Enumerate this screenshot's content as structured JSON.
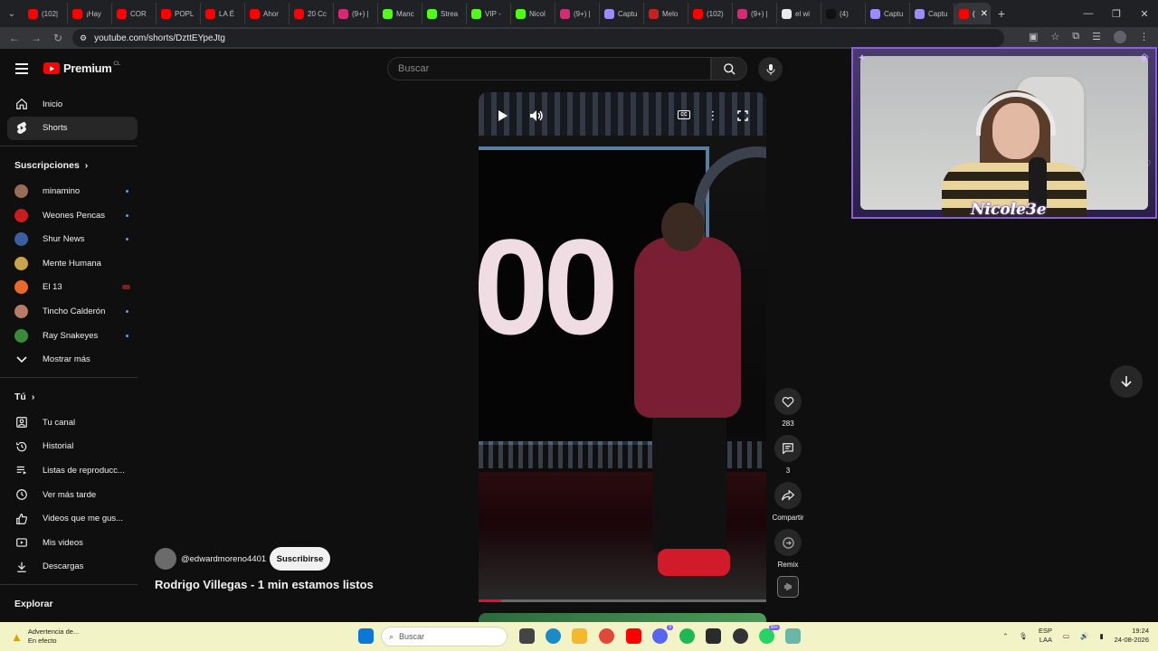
{
  "browser": {
    "tabs": [
      {
        "label": "(102|",
        "color": "#ff0000"
      },
      {
        "label": "¡Hay",
        "color": "#ff0000"
      },
      {
        "label": "COR",
        "color": "#ff0000"
      },
      {
        "label": "POPL",
        "color": "#ff0000"
      },
      {
        "label": "LA É",
        "color": "#ff0000"
      },
      {
        "label": "Ahor",
        "color": "#ff0000"
      },
      {
        "label": "20 Cc",
        "color": "#ff0000"
      },
      {
        "label": "(9+) |",
        "color": "#d62976"
      },
      {
        "label": "Manc",
        "color": "#53fc18"
      },
      {
        "label": "Strea",
        "color": "#53fc18"
      },
      {
        "label": "VIP -",
        "color": "#53fc18"
      },
      {
        "label": "Nicol",
        "color": "#53fc18"
      },
      {
        "label": "(9+) |",
        "color": "#d62976"
      },
      {
        "label": "Captu",
        "color": "#9a8cff"
      },
      {
        "label": "Melo",
        "color": "#c5221f"
      },
      {
        "label": "(102)",
        "color": "#ff0000"
      },
      {
        "label": "(9+) |",
        "color": "#d62976"
      },
      {
        "label": "el wi",
        "color": "#e8eaed"
      },
      {
        "label": "(4)",
        "color": "#111111"
      },
      {
        "label": "Captu",
        "color": "#9a8cff"
      },
      {
        "label": "Captu",
        "color": "#9a8cff"
      },
      {
        "label": "(",
        "color": "#ff0000"
      }
    ],
    "url": "youtube.com/shorts/DzttEYpeJtg"
  },
  "header": {
    "logo_text": "Premium",
    "logo_region": "CL",
    "search_placeholder": "Buscar"
  },
  "sidebar": {
    "main": [
      {
        "label": "Inicio",
        "icon": "home-icon"
      },
      {
        "label": "Shorts",
        "icon": "shorts-icon"
      }
    ],
    "subs_title": "Suscripciones",
    "subs": [
      {
        "label": "minamino",
        "color": "#9b6b5a",
        "indicator": "dot"
      },
      {
        "label": "Weones Pencas",
        "color": "#c91c1c",
        "indicator": "dot"
      },
      {
        "label": "Shur News",
        "color": "#3a5fa0",
        "indicator": "dot"
      },
      {
        "label": "Mente Humana",
        "color": "#c9a24a",
        "indicator": "none"
      },
      {
        "label": "El 13",
        "color": "#e86a2a",
        "indicator": "live"
      },
      {
        "label": "Tincho Calderón",
        "color": "#b77b66",
        "indicator": "dot"
      },
      {
        "label": "Ray Snakeyes",
        "color": "#3a8a3a",
        "indicator": "dot"
      }
    ],
    "show_more": "Mostrar más",
    "you_title": "Tú",
    "you": [
      {
        "label": "Tu canal",
        "icon": "channel-icon"
      },
      {
        "label": "Historial",
        "icon": "history-icon"
      },
      {
        "label": "Listas de reproducc...",
        "icon": "playlists-icon"
      },
      {
        "label": "Ver más tarde",
        "icon": "watch-later-icon"
      },
      {
        "label": "Videos que me gus...",
        "icon": "liked-icon"
      },
      {
        "label": "Mis videos",
        "icon": "my-videos-icon"
      },
      {
        "label": "Descargas",
        "icon": "downloads-icon"
      }
    ],
    "explore_title": "Explorar"
  },
  "video": {
    "overlay_number": "00",
    "progress": 0.08,
    "channel": "@edwardmoreno4401",
    "subscribe": "Suscribirse",
    "title": "Rodrigo Villegas - 1 min estamos listos"
  },
  "actions": {
    "likes": "283",
    "comments": "3",
    "share": "Compartir",
    "remix": "Remix"
  },
  "webcam": {
    "name": "Nicole3e"
  },
  "taskbar": {
    "warning_title": "Advertencia de...",
    "warning_sub": "En efecto",
    "search": "Buscar",
    "lang1": "ESP",
    "lang2": "LAA",
    "time": "19:24",
    "date": "24-08-2026",
    "discord_badge": "9",
    "whatsapp_badge": "99+"
  }
}
